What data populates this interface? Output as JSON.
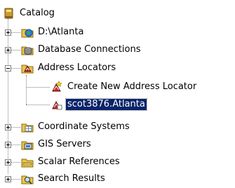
{
  "tree": {
    "root": {
      "label": "Catalog",
      "icon": "catalog-icon"
    },
    "items": [
      {
        "label": "D:\\Atlanta",
        "icon": "folder-globe-icon",
        "expander": "plus"
      },
      {
        "label": "Database Connections",
        "icon": "database-connections-icon",
        "expander": "plus"
      },
      {
        "label": "Address Locators",
        "icon": "address-locators-icon",
        "expander": "minus",
        "children": [
          {
            "label": "Create New Address Locator",
            "icon": "create-address-locator-icon"
          },
          {
            "label": "scot3876.Atlanta",
            "icon": "address-locator-icon",
            "selected": true
          }
        ]
      },
      {
        "label": "Coordinate Systems",
        "icon": "coordinate-systems-icon",
        "expander": "plus"
      },
      {
        "label": "GIS Servers",
        "icon": "gis-servers-icon",
        "expander": "plus"
      },
      {
        "label": "Scalar References",
        "icon": "scalar-references-icon",
        "expander": "plus"
      },
      {
        "label": "Search Results",
        "icon": "search-results-icon",
        "expander": "plus"
      }
    ]
  },
  "colors": {
    "selection_bg": "#0a246a",
    "selection_text": "#ffffff",
    "tree_lines": "#808080"
  }
}
